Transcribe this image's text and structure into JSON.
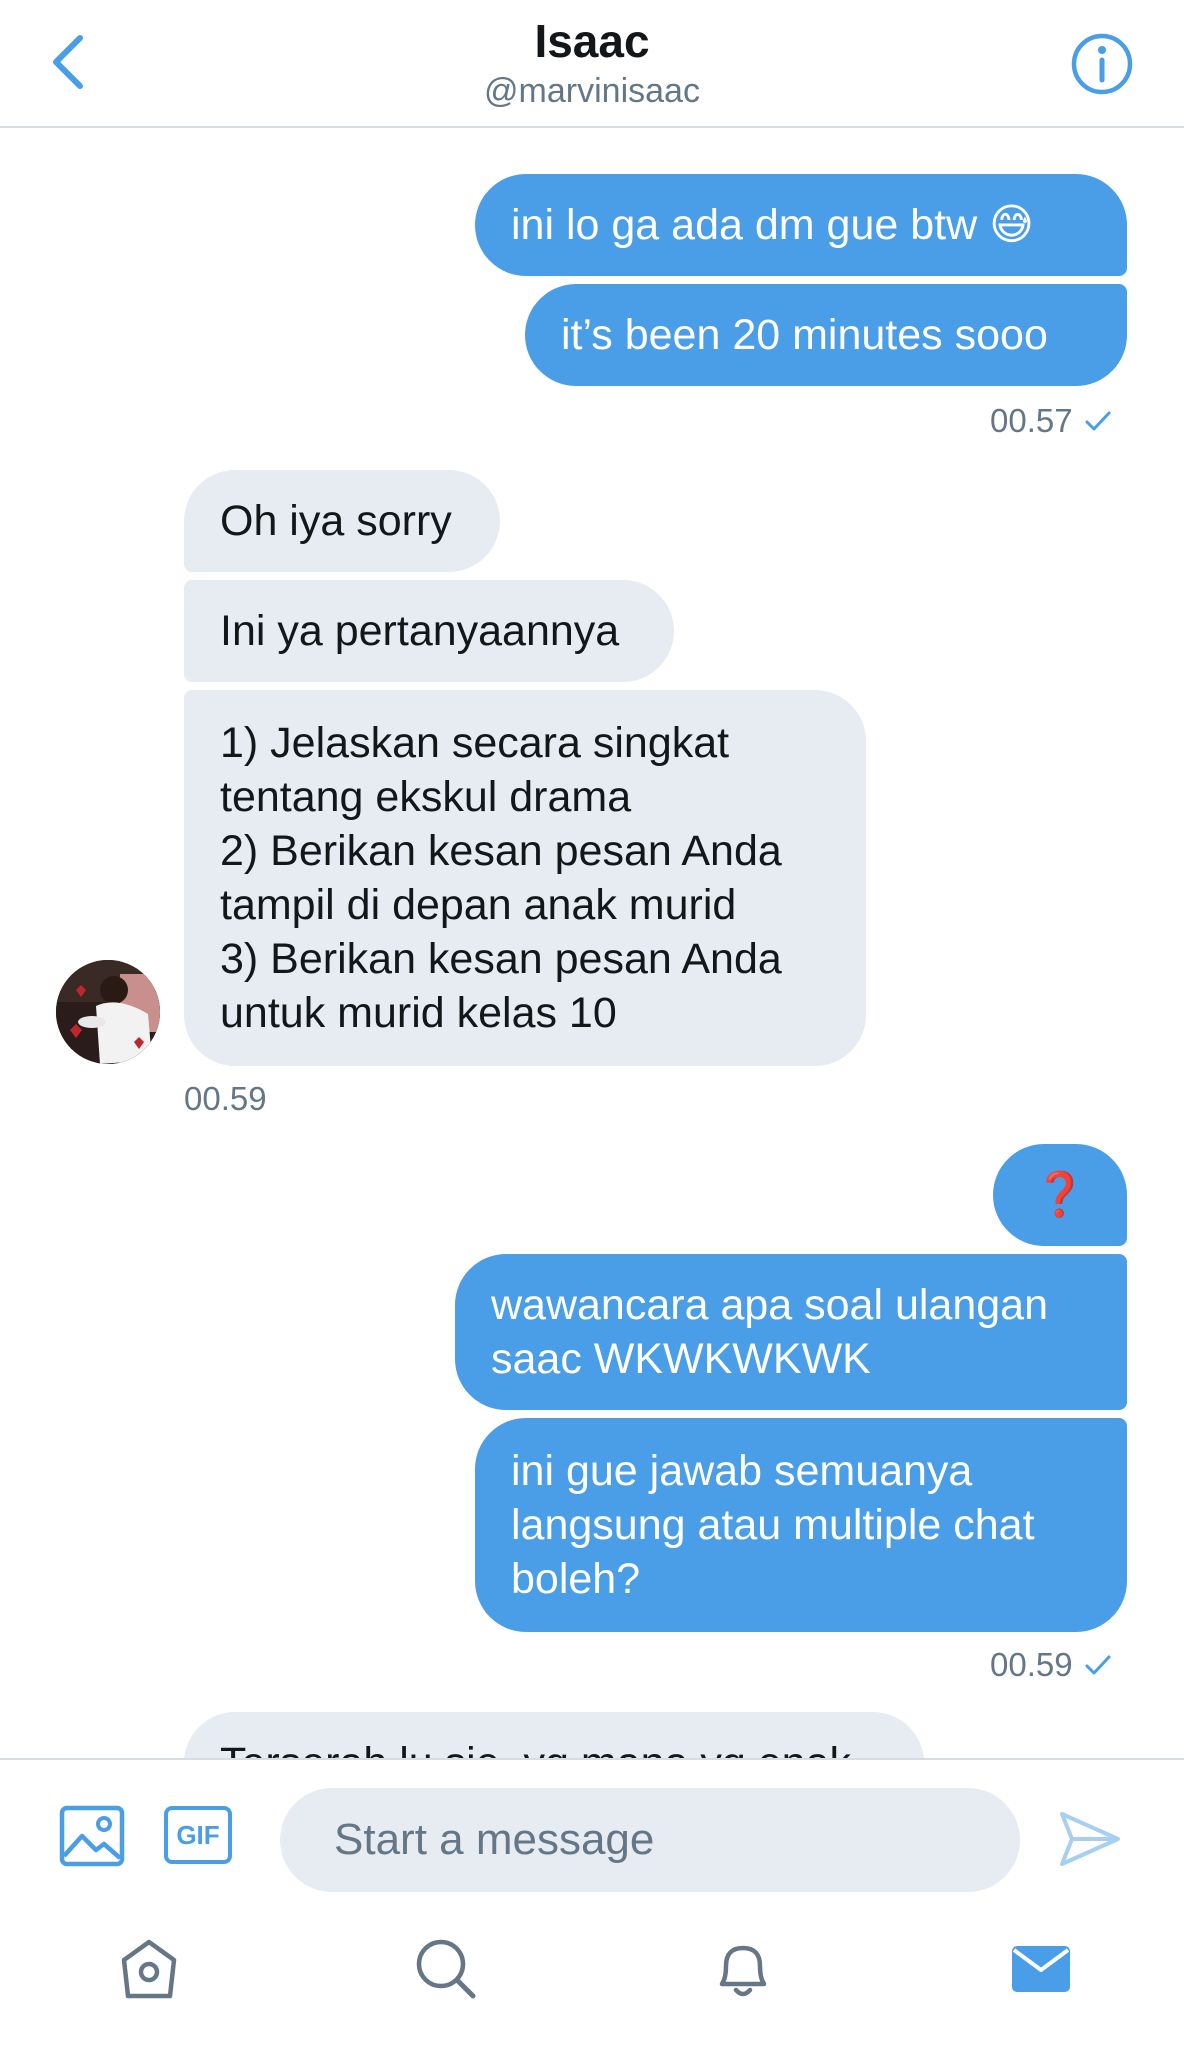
{
  "header": {
    "title": "Isaac",
    "handle": "@marvinisaac"
  },
  "messages": [
    {
      "text": "ini lo ga ada dm gue btw 😅"
    },
    {
      "text": "it’s been 20 minutes sooo"
    },
    {
      "text": "Oh iya sorry"
    },
    {
      "text": "Ini ya pertanyaannya"
    },
    {
      "text": "1) Jelaskan secara singkat\ntentang ekskul drama\n2) Berikan kesan pesan Anda\ntampil di depan anak murid\n3) Berikan kesan pesan Anda\nuntuk murid kelas 10"
    },
    {
      "text": "❓"
    },
    {
      "text": "wawancara apa soal ulangan\nsaac WKWKWKWK"
    },
    {
      "text": "ini gue jawab semuanya\nlangsung atau multiple chat\nboleh?"
    },
    {
      "text": "Terserah lu sie, yg mana yg enak"
    }
  ],
  "timestamps": {
    "t1": "00.57",
    "t2": "00.59",
    "t3": "00.59"
  },
  "composer": {
    "placeholder": "Start a message",
    "gif_label": "GIF"
  },
  "colors": {
    "accent": "#4a9ee8",
    "incoming_bubble": "#e6ecf1",
    "secondary_text": "#657786",
    "divider": "#d8dde2"
  },
  "icons": {
    "back": "chevron-left-icon",
    "info": "info-icon",
    "image": "image-icon",
    "send": "send-icon",
    "home": "home-icon",
    "search": "search-icon",
    "notifications": "bell-icon",
    "messages": "mail-icon",
    "read": "checkmark-icon"
  }
}
